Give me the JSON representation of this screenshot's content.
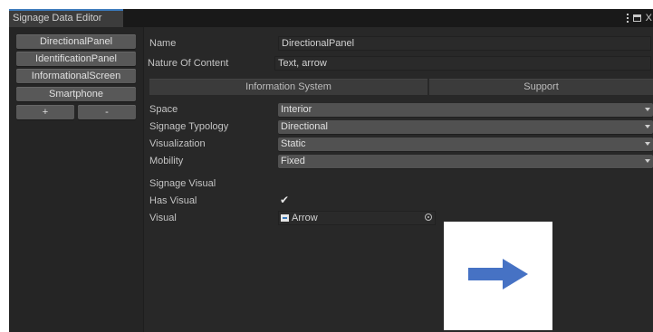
{
  "window": {
    "tab_title": "Signage Data Editor",
    "controls_close": "X"
  },
  "sidebar": {
    "items": [
      {
        "label": "DirectionalPanel"
      },
      {
        "label": "IdentificationPanel"
      },
      {
        "label": "InformationalScreen"
      },
      {
        "label": "Smartphone"
      }
    ],
    "add_label": "+",
    "remove_label": "-"
  },
  "inspector": {
    "name": {
      "label": "Name",
      "value": "DirectionalPanel"
    },
    "nature": {
      "label": "Nature Of Content",
      "value": "Text, arrow"
    },
    "tabs": [
      {
        "label": "Information System"
      },
      {
        "label": "Support"
      }
    ],
    "space": {
      "label": "Space",
      "value": "Interior"
    },
    "typology": {
      "label": "Signage Typology",
      "value": "Directional"
    },
    "visualization": {
      "label": "Visualization",
      "value": "Static"
    },
    "mobility": {
      "label": "Mobility",
      "value": "Fixed"
    },
    "visual_section": {
      "label": "Signage Visual"
    },
    "has_visual": {
      "label": "Has Visual",
      "checked": true,
      "check_glyph": "✔"
    },
    "visual": {
      "label": "Visual",
      "value": "Arrow"
    }
  },
  "colors": {
    "accent_tab": "#3a79bb",
    "arrow": "#4672c4",
    "panel_bg": "#282828"
  }
}
